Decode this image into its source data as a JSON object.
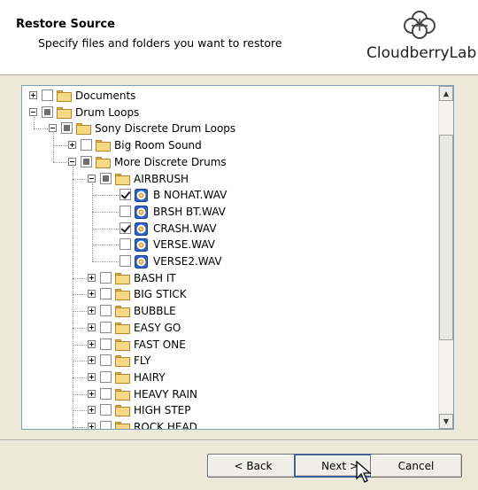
{
  "header": {
    "title": "Restore Source",
    "subtitle": "Specify files and folders you want to restore",
    "logo_text": "CloudberryLab"
  },
  "tree": {
    "items": [
      {
        "label": "Documents",
        "level": 0,
        "expander": "plus",
        "check": "none",
        "icon": "folder"
      },
      {
        "label": "Drum Loops",
        "level": 0,
        "expander": "minus",
        "check": "partial",
        "icon": "folder"
      },
      {
        "label": "Sony Discrete Drum Loops",
        "level": 1,
        "expander": "minus",
        "check": "partial",
        "icon": "folder"
      },
      {
        "label": "Big Room Sound",
        "level": 2,
        "expander": "plus",
        "check": "none",
        "icon": "folder"
      },
      {
        "label": "More Discrete Drums",
        "level": 2,
        "expander": "minus",
        "check": "partial",
        "icon": "folder"
      },
      {
        "label": "AIRBRUSH",
        "level": 3,
        "expander": "minus",
        "check": "partial",
        "icon": "folder"
      },
      {
        "label": "B NOHAT.WAV",
        "level": 4,
        "expander": "",
        "check": "checked",
        "icon": "wav"
      },
      {
        "label": "BRSH BT.WAV",
        "level": 4,
        "expander": "",
        "check": "none",
        "icon": "wav"
      },
      {
        "label": "CRASH.WAV",
        "level": 4,
        "expander": "",
        "check": "checked",
        "icon": "wav"
      },
      {
        "label": "VERSE.WAV",
        "level": 4,
        "expander": "",
        "check": "none",
        "icon": "wav"
      },
      {
        "label": "VERSE2.WAV",
        "level": 4,
        "expander": "",
        "check": "none",
        "icon": "wav"
      },
      {
        "label": "BASH IT",
        "level": 3,
        "expander": "plus",
        "check": "none",
        "icon": "folder"
      },
      {
        "label": "BIG STICK",
        "level": 3,
        "expander": "plus",
        "check": "none",
        "icon": "folder"
      },
      {
        "label": "BUBBLE",
        "level": 3,
        "expander": "plus",
        "check": "none",
        "icon": "folder"
      },
      {
        "label": "EASY GO",
        "level": 3,
        "expander": "plus",
        "check": "none",
        "icon": "folder"
      },
      {
        "label": "FAST ONE",
        "level": 3,
        "expander": "plus",
        "check": "none",
        "icon": "folder"
      },
      {
        "label": "FLY",
        "level": 3,
        "expander": "plus",
        "check": "none",
        "icon": "folder"
      },
      {
        "label": "HAIRY",
        "level": 3,
        "expander": "plus",
        "check": "none",
        "icon": "folder"
      },
      {
        "label": "HEAVY RAIN",
        "level": 3,
        "expander": "plus",
        "check": "none",
        "icon": "folder"
      },
      {
        "label": "HIGH STEP",
        "level": 3,
        "expander": "plus",
        "check": "none",
        "icon": "folder"
      },
      {
        "label": "ROCK HEAD",
        "level": 3,
        "expander": "plus",
        "check": "none",
        "icon": "folder"
      }
    ]
  },
  "buttons": {
    "back": "< Back",
    "next": "Next >",
    "cancel": "Cancel"
  },
  "icons": {
    "folder": "folder-icon",
    "wav": "audio-file-icon",
    "logo": "cloud-logo-icon",
    "cursor": "mouse-pointer-icon"
  }
}
